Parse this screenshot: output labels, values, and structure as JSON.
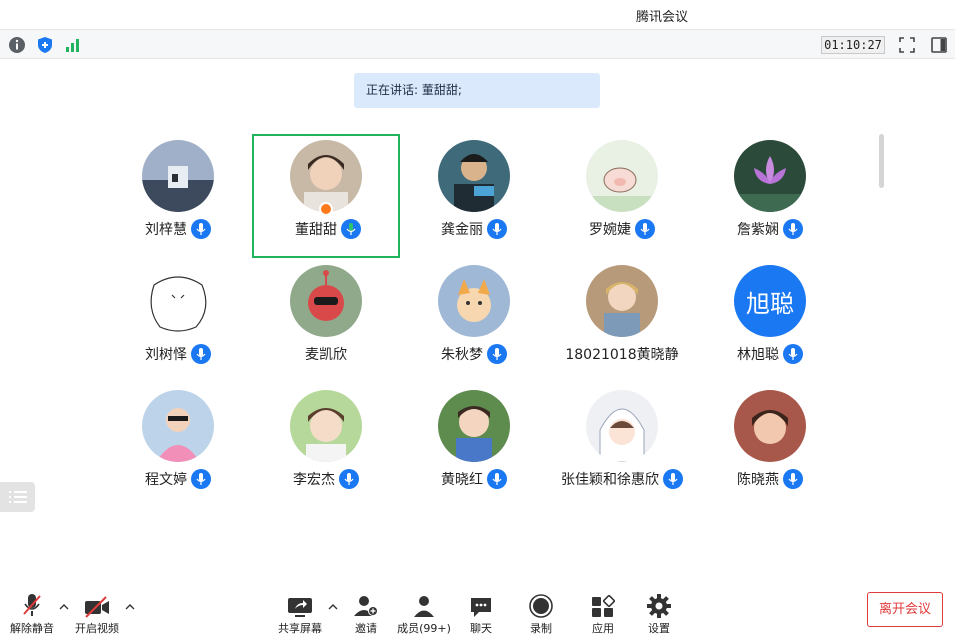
{
  "window": {
    "title": "腾讯会议"
  },
  "infobar": {
    "timer": "01:10:27"
  },
  "speaking": {
    "label": "正在讲话: 董甜甜;"
  },
  "participants": [
    {
      "name": "刘梓慧",
      "mic": "on"
    },
    {
      "name": "董甜甜",
      "mic": "speaking"
    },
    {
      "name": "龚金丽",
      "mic": "on"
    },
    {
      "name": "罗婉婕",
      "mic": "on"
    },
    {
      "name": "詹紫娴",
      "mic": "on"
    },
    {
      "name": "刘树怿",
      "mic": "on"
    },
    {
      "name": "麦凯欣",
      "mic": "none"
    },
    {
      "name": "朱秋梦",
      "mic": "on"
    },
    {
      "name": "18021018黄晓静",
      "mic": "none"
    },
    {
      "name": "林旭聪",
      "mic": "on",
      "avatar_text": "旭聪"
    },
    {
      "name": "程文婷",
      "mic": "on"
    },
    {
      "name": "李宏杰",
      "mic": "on"
    },
    {
      "name": "黄晓红",
      "mic": "on"
    },
    {
      "name": "张佳颖和徐惠欣",
      "mic": "on"
    },
    {
      "name": "陈晓燕",
      "mic": "on"
    }
  ],
  "toolbar": {
    "unmute": "解除静音",
    "start_video": "开启视频",
    "share_screen": "共享屏幕",
    "invite": "邀请",
    "members": "成员(99+)",
    "chat": "聊天",
    "record": "录制",
    "apps": "应用",
    "settings": "设置",
    "leave": "离开会议"
  },
  "colors": {
    "accent": "#1a78f2",
    "speaking": "#22b35e",
    "danger": "#e03a3a"
  }
}
